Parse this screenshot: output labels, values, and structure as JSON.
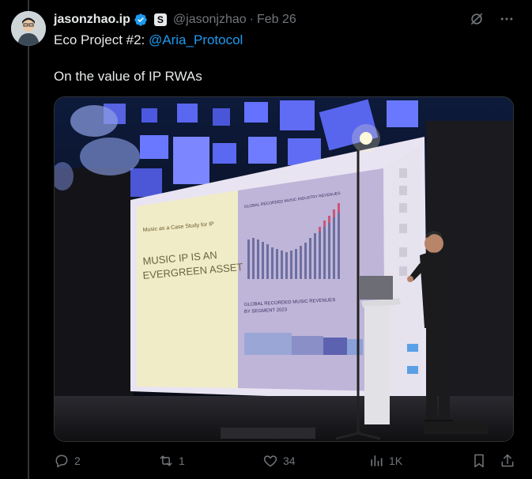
{
  "post": {
    "author_name": "jasonzhao.ip",
    "author_handle": "@jasonjzhao",
    "separator": "·",
    "date": "Feb 26",
    "text_line1_prefix": "Eco Project #2: ",
    "mention": "@Aria_Protocol",
    "text_line2": "On the value of IP RWAs"
  },
  "slide": {
    "left_kicker": "Music as a Case Study for IP",
    "left_headline_1": "MUSIC IP IS AN",
    "left_headline_2": "EVERGREEN ASSET",
    "right_title_1": "GLOBAL RECORDED MUSIC INDUSTRY REVENUES",
    "right_title_2": "GLOBAL RECORDED MUSIC REVENUES",
    "right_title_3": "BY SEGMENT 2023"
  },
  "actions": {
    "replies": "2",
    "reposts": "1",
    "likes": "34",
    "views": "1K"
  },
  "colors": {
    "accent": "#1d9bf0",
    "muted": "#71767b",
    "background": "#000000"
  }
}
